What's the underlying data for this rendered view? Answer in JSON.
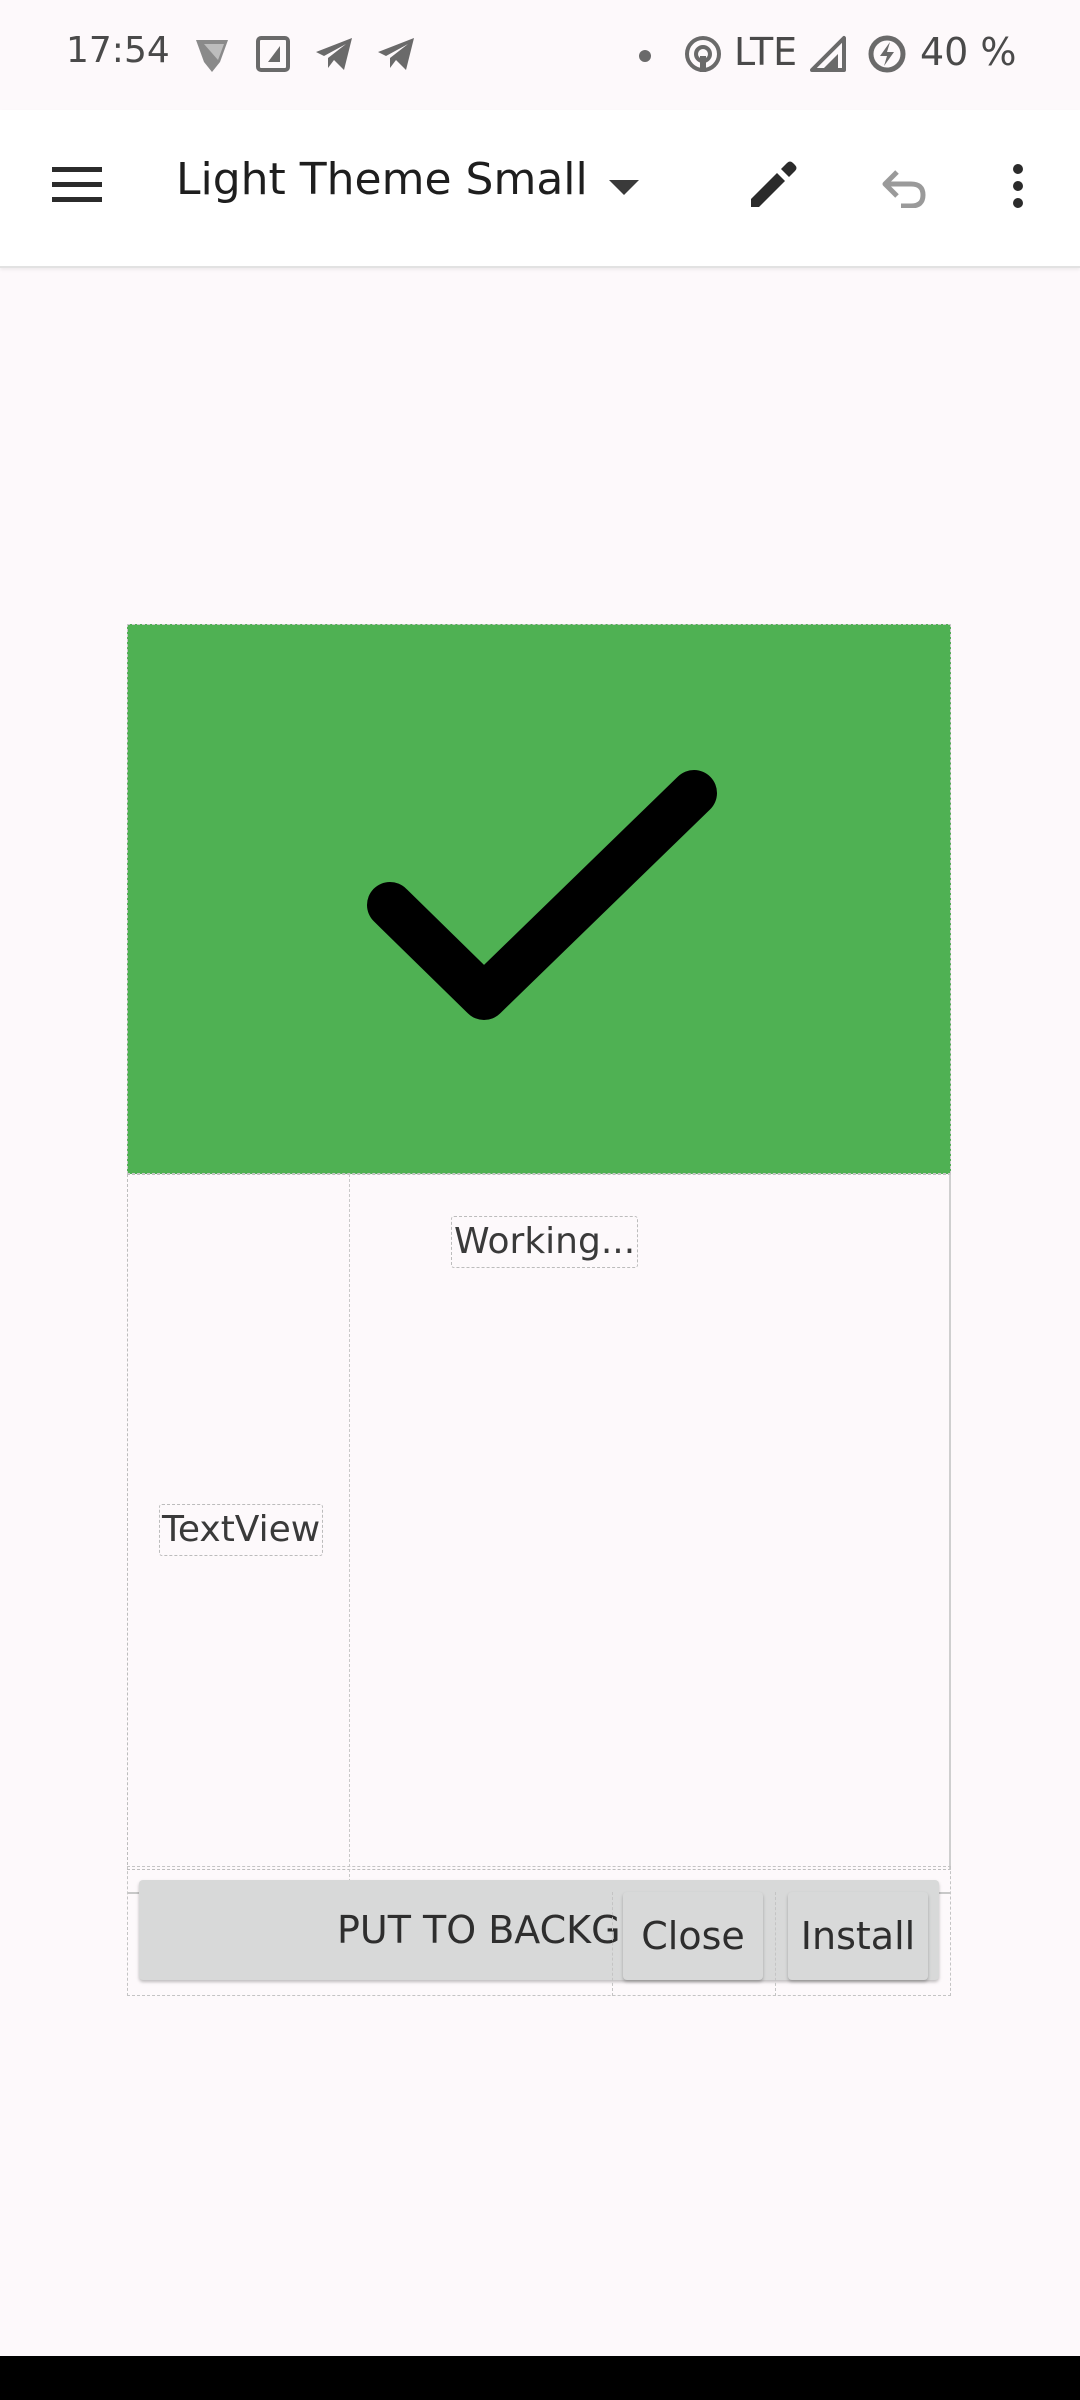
{
  "status_bar": {
    "time": "17:54",
    "network": "LTE",
    "battery": "40 %",
    "icons": [
      "notification-app-icon",
      "screenshot-icon",
      "telegram-icon",
      "telegram-icon",
      "dot-icon",
      "hotspot-icon",
      "signal-icon",
      "battery-saver-icon"
    ]
  },
  "toolbar": {
    "title": "Light Theme Small",
    "icons": [
      "menu-icon",
      "dropdown-arrow-icon",
      "edit-icon",
      "undo-icon",
      "more-icon"
    ]
  },
  "preview": {
    "banner_color": "#4fb153",
    "working_label": "Working...",
    "textview_label": "TextView",
    "background_button": "PUT TO BACKGROUND",
    "close_button": "Close",
    "install_button": "Install"
  }
}
